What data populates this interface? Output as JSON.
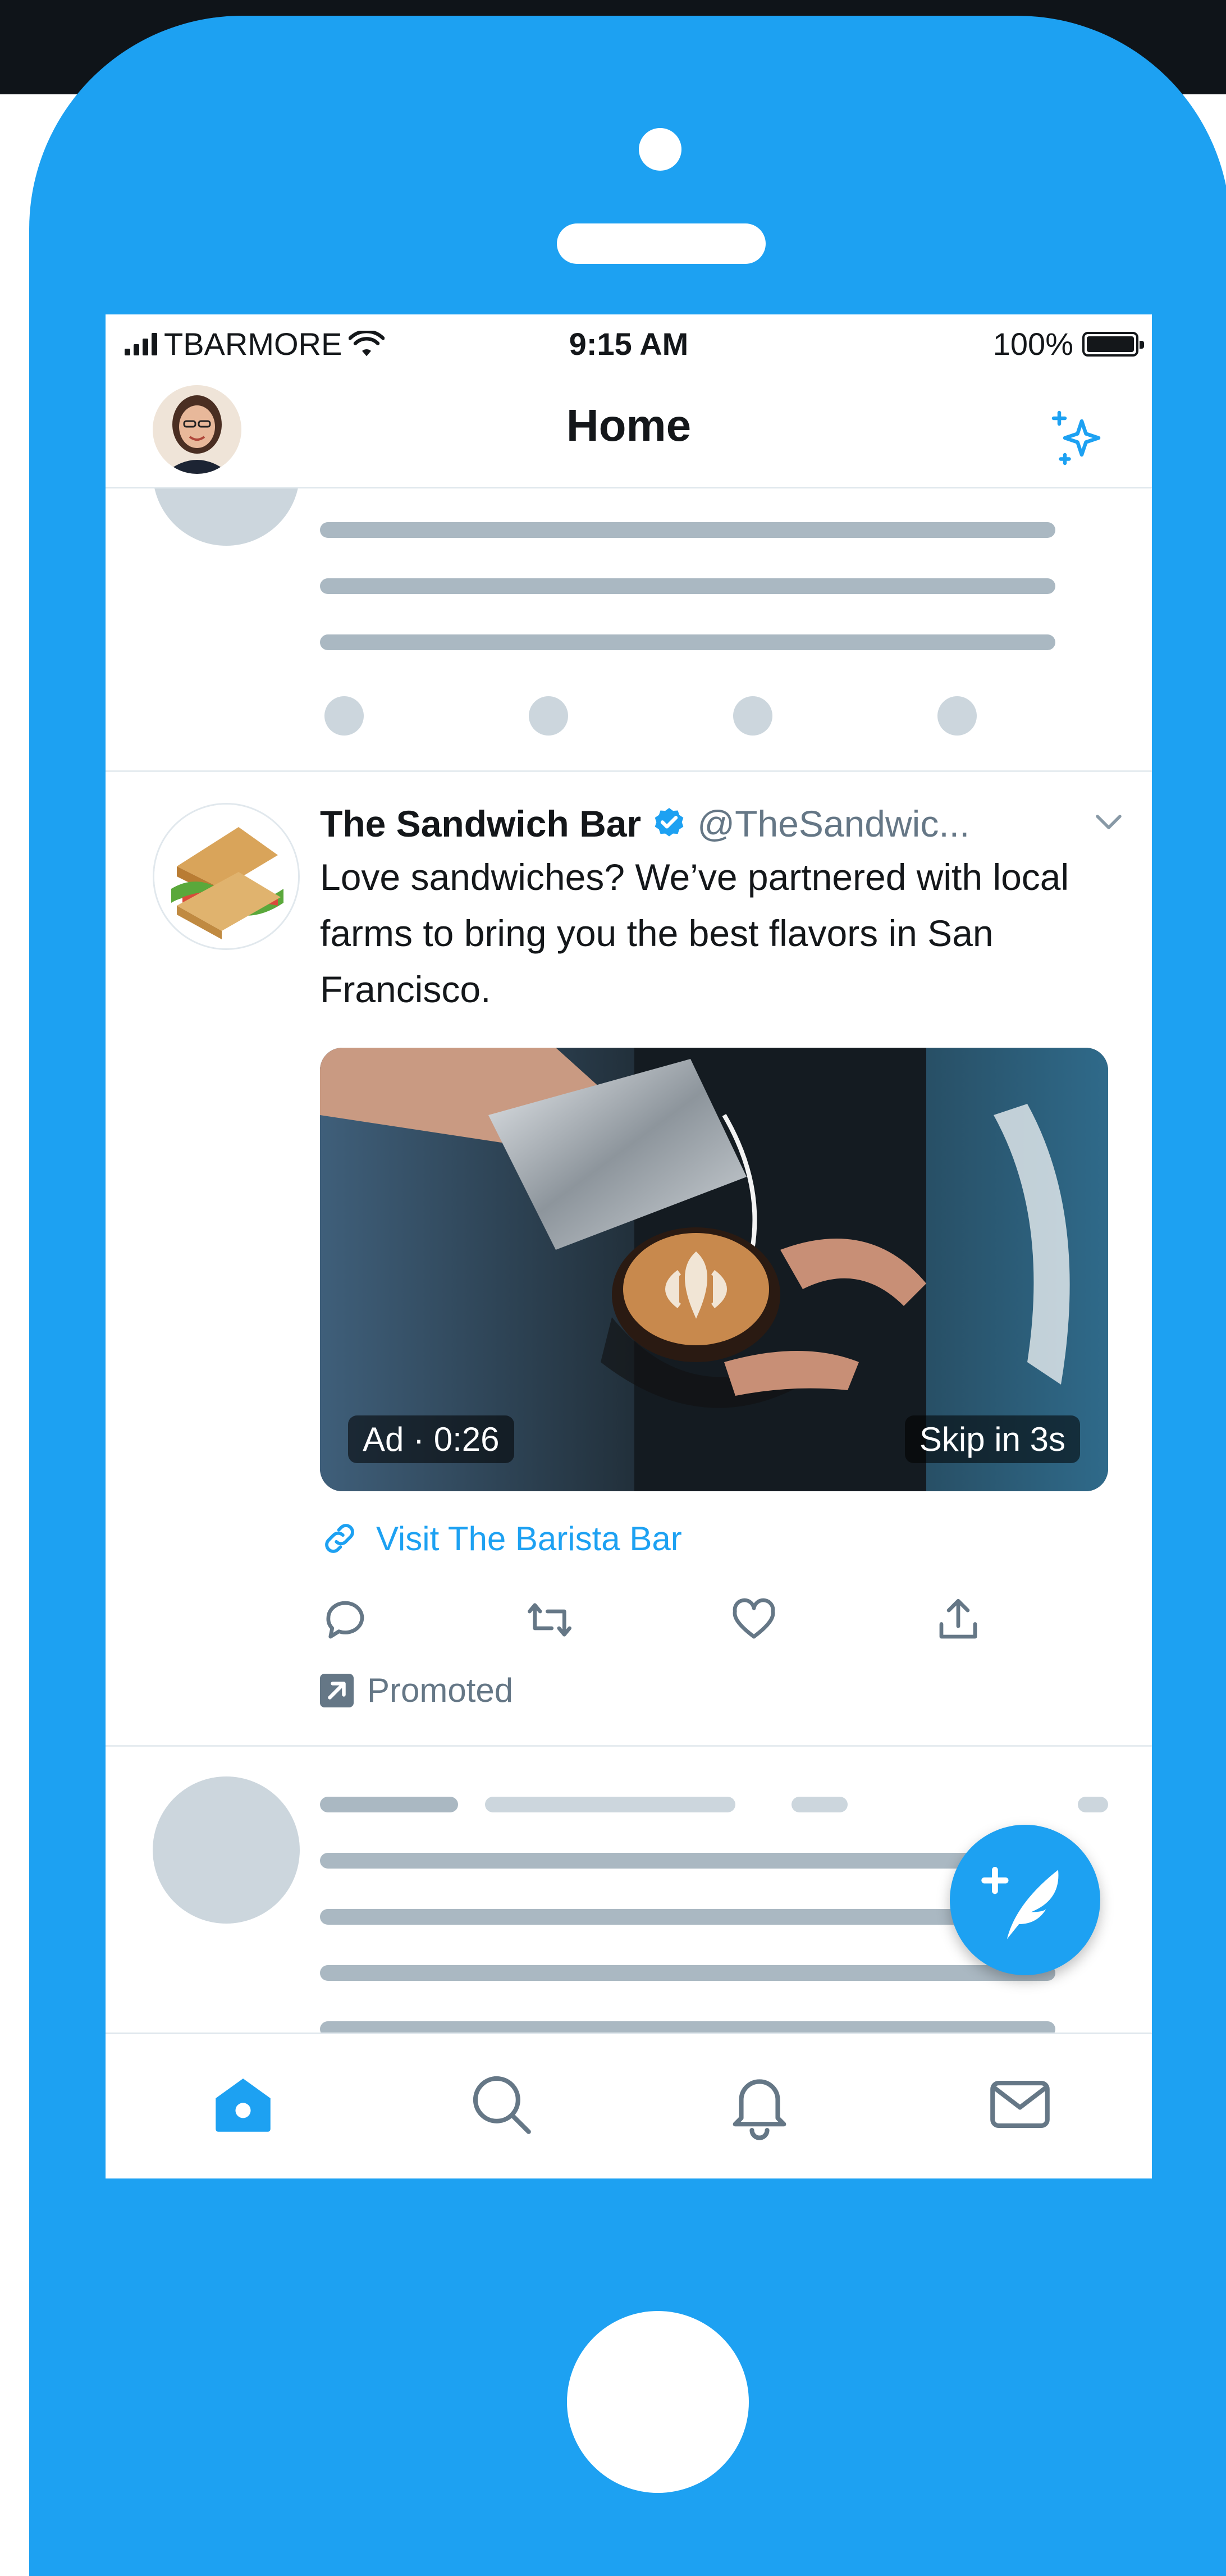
{
  "status_bar": {
    "carrier": "TBARMORE",
    "time": "9:15 AM",
    "battery": "100%"
  },
  "header": {
    "title": "Home"
  },
  "promoted_tweet": {
    "author_name": "The Sandwich Bar",
    "handle": "@TheSandwic...",
    "text": "Love sandwiches? We’ve partnered with local farms to bring you the best flavors in San Francisco.",
    "media": {
      "ad_label": "Ad · 0:26",
      "skip_label": "Skip in 3s"
    },
    "link_text": "Visit The Barista Bar",
    "promoted_label": "Promoted"
  },
  "icons": {
    "sparkle": "sparkle-icon",
    "compose": "compose-feather-icon",
    "tabs": [
      "home-icon",
      "search-icon",
      "notifications-icon",
      "messages-icon"
    ]
  },
  "colors": {
    "brand": "#1da1f2",
    "text": "#14171a",
    "secondary_text": "#657786",
    "skeleton": "#aab8c2"
  }
}
